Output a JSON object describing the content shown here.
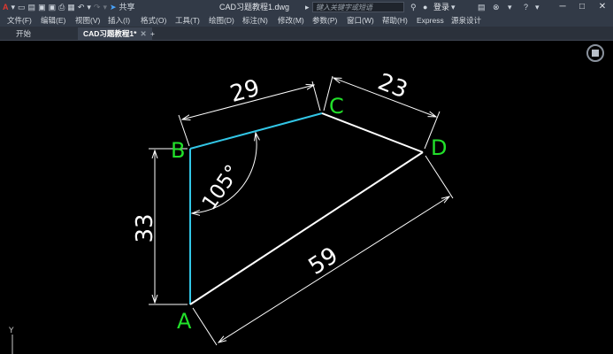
{
  "titlebar": {
    "app_logo": "A",
    "quick_access_icons": [
      "new-icon",
      "open-icon",
      "save-icon",
      "saveas-icon",
      "print-icon",
      "undo-icon",
      "redo-icon",
      "share-icon"
    ],
    "share_label": "共享",
    "document_title": "CAD习题教程1.dwg",
    "search_placeholder": "键入关键字或短语",
    "login_label": "登录",
    "minimize": "─",
    "maximize": "□",
    "close": "✕"
  },
  "menubar": {
    "items": [
      "文件(F)",
      "编辑(E)",
      "视图(V)",
      "插入(I)",
      "格式(O)",
      "工具(T)",
      "绘图(D)",
      "标注(N)",
      "修改(M)",
      "参数(P)",
      "窗口(W)",
      "帮助(H)",
      "Express",
      "源泉设计"
    ]
  },
  "tabs": {
    "start_label": "开始",
    "active_label": "CAD习题教程1*",
    "add_label": "+"
  },
  "drawing": {
    "points": {
      "A": "A",
      "B": "B",
      "C": "C",
      "D": "D"
    },
    "dimensions": {
      "AB": "33",
      "BC": "29",
      "CD": "23",
      "AD": "59",
      "angle_B": "105°"
    },
    "ucs_label": "Y",
    "colors": {
      "label": "#22e02a",
      "edge_AB_BC": "#32c6e6",
      "edge_other": "#ffffff",
      "dimension": "#ffffff",
      "background": "#000000"
    }
  }
}
